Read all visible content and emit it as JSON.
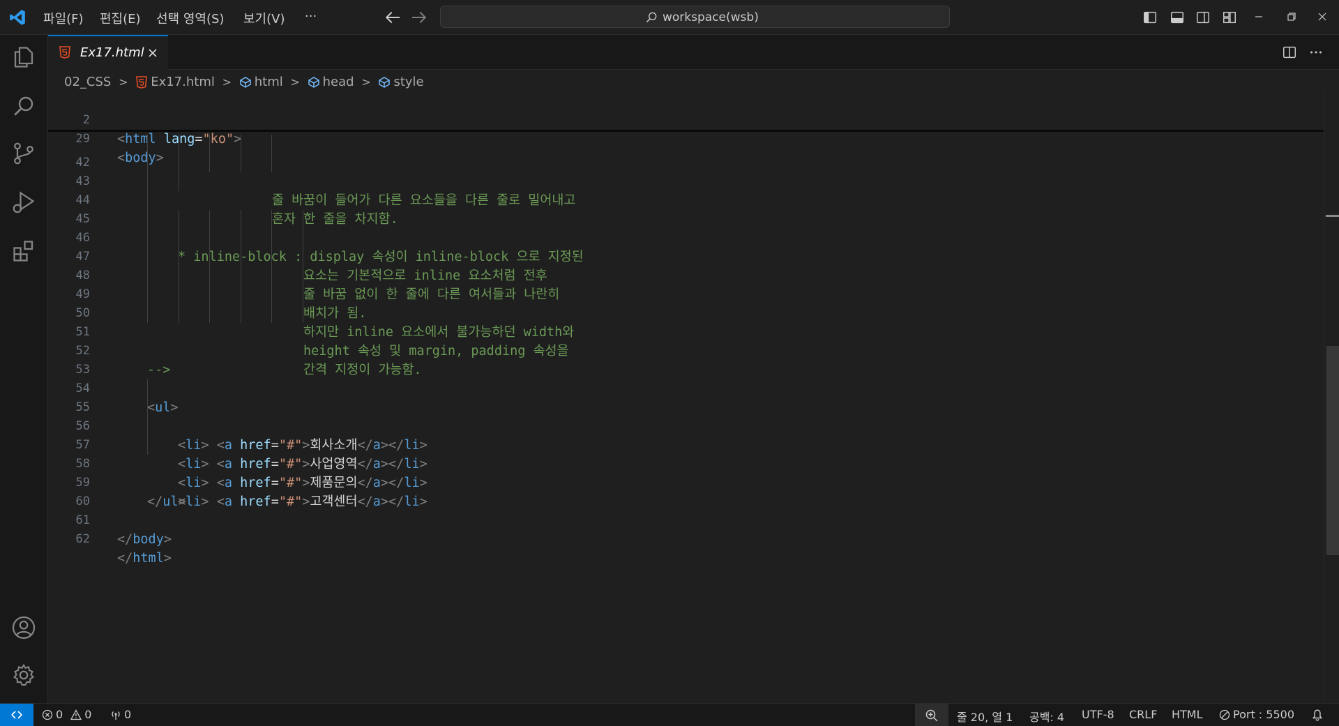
{
  "titlebar": {
    "menus": [
      "파일(F)",
      "편집(E)",
      "선택 영역(S)",
      "보기(V)",
      "···"
    ],
    "search_text": "workspace(wsb)"
  },
  "tab": {
    "label": "Ex17.html",
    "close": "×"
  },
  "breadcrumb": {
    "folder": "02_CSS",
    "file": "Ex17.html",
    "items": [
      "html",
      "head",
      "style"
    ],
    "sep": ">"
  },
  "sticky": [
    {
      "num": "2",
      "code": "<html lang=\"ko\">"
    },
    {
      "num": "29",
      "code": "<body>"
    }
  ],
  "editor": {
    "lines": [
      {
        "num": "42",
        "text": "줄 바꿈이 들어가 다른 요소들을 다른 줄로 밀어내고"
      },
      {
        "num": "43",
        "text": "혼자 한 줄을 차지함."
      },
      {
        "num": "44",
        "text": ""
      },
      {
        "num": "45",
        "text": "* inline-block : display 속성이 inline-block 으로 지정된"
      },
      {
        "num": "46",
        "text": "요소는 기본적으로 inline 요소처럼 전후"
      },
      {
        "num": "47",
        "text": "줄 바꿈 없이 한 줄에 다른 여서들과 나란히"
      },
      {
        "num": "48",
        "text": "배치가 됨."
      },
      {
        "num": "49",
        "text": "하지만 inline 요소에서 불가능하던 width와"
      },
      {
        "num": "50",
        "text": "height 속성 및 margin, padding 속성을"
      },
      {
        "num": "51",
        "text": "간격 지정이 가능함."
      },
      {
        "num": "52",
        "text": "-->"
      },
      {
        "num": "53",
        "text": ""
      },
      {
        "num": "54",
        "text": "<ul>"
      },
      {
        "num": "55",
        "text": "회사소개"
      },
      {
        "num": "56",
        "text": "사업영역"
      },
      {
        "num": "57",
        "text": "제품문의"
      },
      {
        "num": "58",
        "text": "고객센터"
      },
      {
        "num": "59",
        "text": "</ul>"
      },
      {
        "num": "60",
        "text": ""
      },
      {
        "num": "61",
        "text": "</body>"
      },
      {
        "num": "62",
        "text": "</html>"
      }
    ]
  },
  "statusbar": {
    "errors": "0",
    "warnings": "0",
    "ports": "0",
    "position": "줄 20, 열 1",
    "spaces": "공백: 4",
    "encoding": "UTF-8",
    "eol": "CRLF",
    "language": "HTML",
    "port": "Port : 5500"
  },
  "colors": {
    "accent": "#0078d4",
    "html_icon": "#e44d26"
  }
}
